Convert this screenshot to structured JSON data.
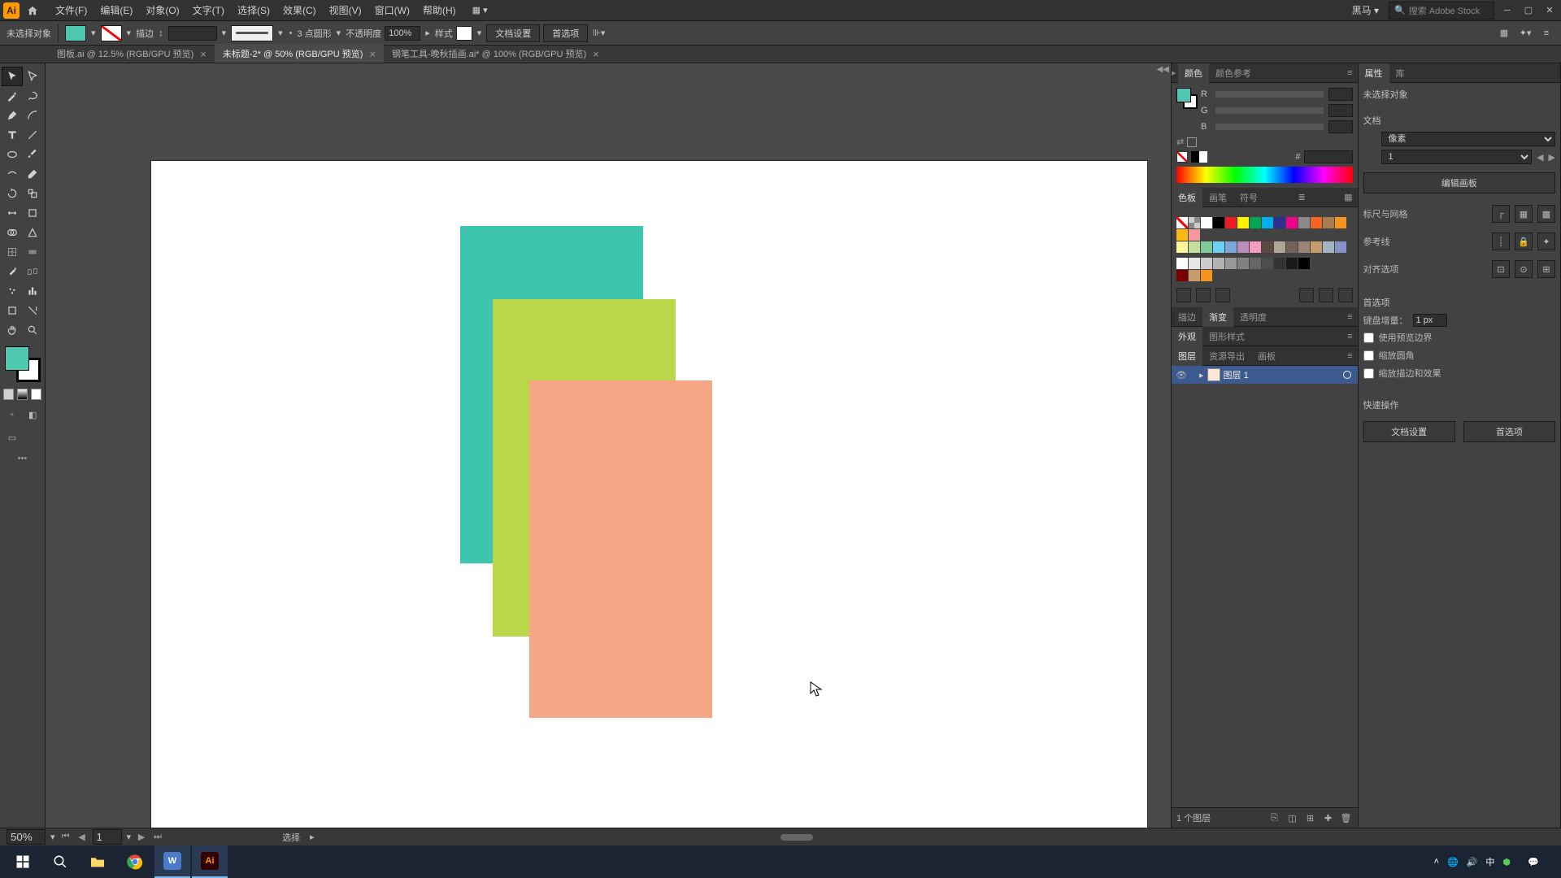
{
  "menubar": {
    "app_letter": "Ai",
    "items": [
      "文件(F)",
      "编辑(E)",
      "对象(O)",
      "文字(T)",
      "选择(S)",
      "效果(C)",
      "视图(V)",
      "窗口(W)",
      "帮助(H)"
    ],
    "user": "黑马",
    "search_placeholder": "搜索 Adobe Stock"
  },
  "optionsbar": {
    "no_selection": "未选择对象",
    "stroke_label": "描边",
    "stroke_value": "",
    "brush_label": "3 点圆形",
    "opacity_label": "不透明度",
    "opacity_value": "100%",
    "style_label": "样式",
    "doc_setup": "文档设置",
    "prefs": "首选项"
  },
  "tabs": [
    {
      "label": "图板.ai @ 12.5% (RGB/GPU 预览)",
      "active": false
    },
    {
      "label": "未标题-2* @ 50% (RGB/GPU 预览)",
      "active": true
    },
    {
      "label": "钢笔工具-晚秋插画.ai* @ 100% (RGB/GPU 预览)",
      "active": false
    }
  ],
  "colors": {
    "fill": "#4ec9b0",
    "rect1": "#3dc5ad",
    "rect2": "#b9d748",
    "rect3": "#f5a684"
  },
  "color_panel": {
    "tab_color": "颜色",
    "tab_guide": "颜色参考",
    "channels": [
      "R",
      "G",
      "B"
    ],
    "hex_label": "#"
  },
  "swatches_panel": {
    "tab_swatches": "色板",
    "tab_brushes": "画笔",
    "tab_symbols": "符号",
    "colors_row1": [
      "#ffffff",
      "#000000",
      "#ed1c24",
      "#fff200",
      "#00a651",
      "#00aeef",
      "#2e3192",
      "#ec008c",
      "#898989",
      "#f26522",
      "#a97c50",
      "#f7941d",
      "#fdb913",
      "#f5989d"
    ],
    "colors_row2": [
      "#fff799",
      "#c4df9b",
      "#82ca9c",
      "#6dcff6",
      "#7da7d9",
      "#bd8cbf",
      "#f49ac1",
      "#594a42",
      "#b0a696",
      "#726257",
      "#9b8579",
      "#c69c6d",
      "#a3b6c4",
      "#8393ca"
    ],
    "grays": [
      "#ffffff",
      "#e6e6e6",
      "#cccccc",
      "#b3b3b3",
      "#999999",
      "#808080",
      "#666666",
      "#4d4d4d",
      "#333333",
      "#1a1a1a",
      "#000000"
    ],
    "colors_row3": [
      "#790000",
      "#c69c6d",
      "#f7941d"
    ]
  },
  "appearance_panel": {
    "tab_stroke": "描边",
    "tab_gradient": "渐变",
    "tab_trans": "透明度"
  },
  "graphic_panel": {
    "tab_appear": "外观",
    "tab_graphic": "图形样式"
  },
  "layers_panel": {
    "tab_layers": "图层",
    "tab_asset": "资源导出",
    "tab_artboard": "画板",
    "layer_name": "图层 1",
    "footer_count": "1 个图层"
  },
  "props_panel": {
    "tab_props": "属性",
    "tab_lib": "库",
    "no_sel": "未选择对象",
    "doc_section": "文档",
    "units_label": "像素",
    "artboard_val": "1",
    "edit_artboards": "编辑画板",
    "ruler_grid": "标尺与网格",
    "guides": "参考线",
    "align": "对齐选项",
    "prefs_section": "首选项",
    "key_inc_label": "键盘增量：",
    "key_inc_val": "1 px",
    "use_preview": "使用预览边界",
    "scale_corners": "缩放圆角",
    "scale_stroke": "缩放描边和效果",
    "quick_section": "快速操作",
    "doc_setup_btn": "文档设置",
    "prefs_btn": "首选项"
  },
  "statusbar": {
    "zoom": "50%",
    "artboard_num": "1",
    "tool": "选择"
  },
  "taskbar": {
    "time": ""
  }
}
